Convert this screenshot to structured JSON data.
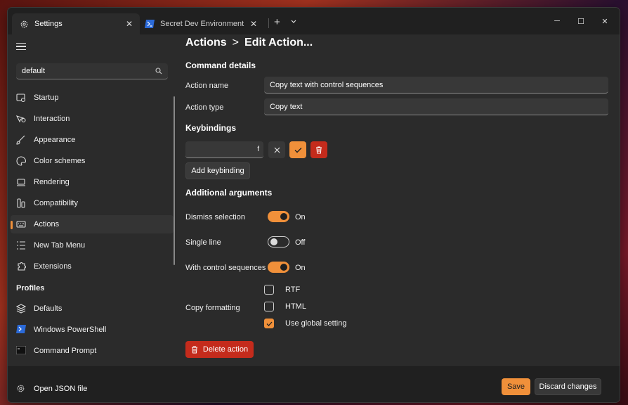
{
  "tabs": [
    {
      "label": "Settings",
      "icon": "gear-icon",
      "active": true
    },
    {
      "label": "Secret Dev Environment",
      "icon": "powershell-icon",
      "active": false
    }
  ],
  "titlebar": {
    "new_tab": "+",
    "minimize": "─",
    "maximize": "☐",
    "close": "✕"
  },
  "search": {
    "value": "default"
  },
  "nav": [
    {
      "label": "Startup",
      "icon": "startup-icon"
    },
    {
      "label": "Interaction",
      "icon": "interaction-icon"
    },
    {
      "label": "Appearance",
      "icon": "brush-icon"
    },
    {
      "label": "Color schemes",
      "icon": "palette-icon"
    },
    {
      "label": "Rendering",
      "icon": "monitor-icon"
    },
    {
      "label": "Compatibility",
      "icon": "compatibility-icon"
    },
    {
      "label": "Actions",
      "icon": "keyboard-icon",
      "selected": true
    },
    {
      "label": "New Tab Menu",
      "icon": "list-icon"
    },
    {
      "label": "Extensions",
      "icon": "puzzle-icon"
    }
  ],
  "profiles": {
    "heading": "Profiles",
    "items": [
      {
        "label": "Defaults",
        "icon": "layers-icon"
      },
      {
        "label": "Windows PowerShell",
        "icon": "powershell-icon"
      },
      {
        "label": "Command Prompt",
        "icon": "cmd-icon"
      }
    ]
  },
  "footer": {
    "open_json": "Open JSON file",
    "save": "Save",
    "discard": "Discard changes"
  },
  "main": {
    "breadcrumb": [
      "Actions",
      "Edit Action..."
    ],
    "breadcrumb_sep": ">",
    "command_details": "Command details",
    "action_name_label": "Action name",
    "action_name_value": "Copy text with control sequences",
    "action_type_label": "Action type",
    "action_type_value": "Copy text",
    "keybindings": "Keybindings",
    "keybinding_value": "f",
    "add_keybinding": "Add keybinding",
    "additional_arguments": "Additional arguments",
    "dismiss_selection": {
      "label": "Dismiss selection",
      "state": "On",
      "on": true
    },
    "single_line": {
      "label": "Single line",
      "state": "Off",
      "on": false
    },
    "control_sequences": {
      "label": "With control sequences",
      "state": "On",
      "on": true
    },
    "copy_formatting": {
      "label": "Copy formatting",
      "options": [
        {
          "label": "RTF",
          "checked": false
        },
        {
          "label": "HTML",
          "checked": false
        },
        {
          "label": "Use global setting",
          "checked": true
        }
      ]
    },
    "delete_action": "Delete action"
  },
  "colors": {
    "accent": "#f0903a",
    "danger": "#c42b1c"
  }
}
